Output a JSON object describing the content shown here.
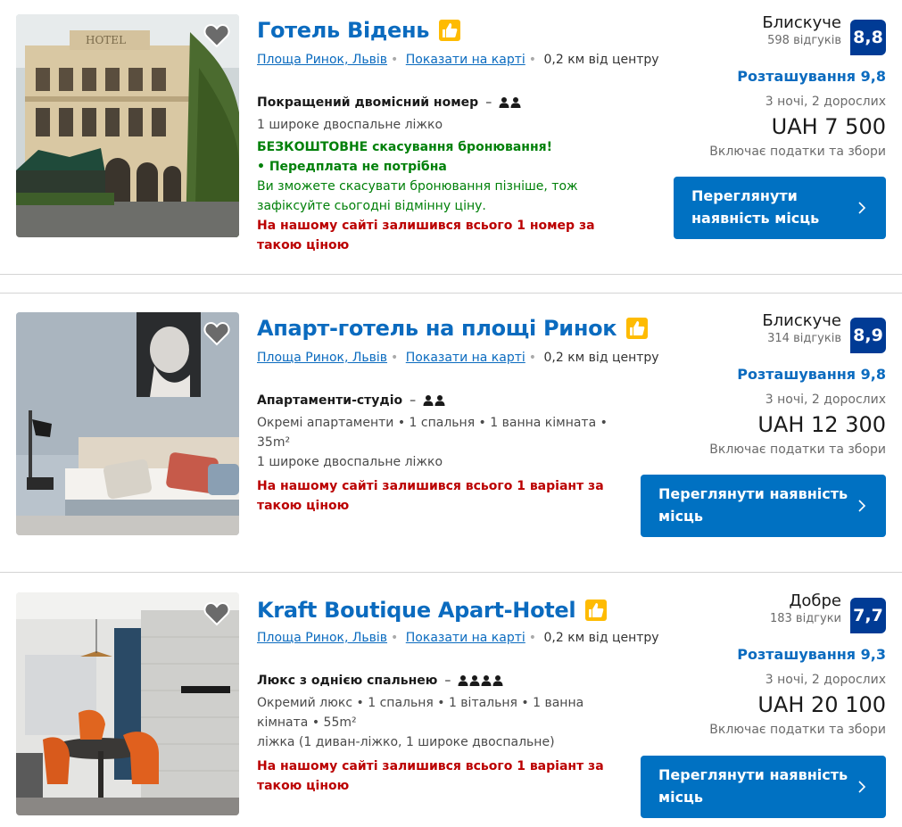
{
  "listings": [
    {
      "title": "Готель Відень",
      "address": "Площа Ринок, Львів",
      "map_link": "Показати на карті",
      "distance": "0,2 км від центру",
      "room_name": "Покращений двомісний номер",
      "room_desc": "",
      "bed": "1 широке двоспальне ліжко",
      "free_cancel": "БЕЗКОШТОВНЕ скасування бронювання!",
      "no_prepay": "• Передплата не потрібна",
      "cancel_note": "Ви зможете скасувати бронювання пізніше, тож зафіксуйте сьогодні відмінну ціну.",
      "scarcity": "На нашому сайті залишився всього 1 номер за такою ціною",
      "score_word": "Блискуче",
      "reviews": "598 відгуків",
      "score": "8,8",
      "location_score": "Розташування 9,8",
      "stay": "3 ночі, 2 дорослих",
      "price": "UAH 7 500",
      "taxes": "Включає податки та збори",
      "cta": "Переглянути наявність місць",
      "occupancy": 2
    },
    {
      "title": "Апарт-готель на площі Ринок",
      "address": "Площа Ринок, Львів",
      "map_link": "Показати на карті",
      "distance": "0,2 км від центру",
      "room_name": "Апартаменти-студіо",
      "room_desc": "Окремі апартаменти • 1 спальня • 1 ванна кімната • 35m²",
      "bed": "1 широке двоспальне ліжко",
      "scarcity": "На нашому сайті залишився всього 1 варіант за такою ціною",
      "score_word": "Блискуче",
      "reviews": "314 відгуків",
      "score": "8,9",
      "location_score": "Розташування 9,8",
      "stay": "3 ночі, 2 дорослих",
      "price": "UAH 12 300",
      "taxes": "Включає податки та збори",
      "cta": "Переглянути наявність місць",
      "occupancy": 2
    },
    {
      "title": "Kraft Boutique Apart-Hotel",
      "address": "Площа Ринок, Львів",
      "map_link": "Показати на карті",
      "distance": "0,2 км від центру",
      "room_name": "Люкс з однією спальнею",
      "room_desc": "Окремий люкс • 1 спальня • 1 вітальня • 1 ванна кімната • 55m²",
      "bed": "ліжка (1 диван-ліжко, 1 широке двоспальне)",
      "scarcity": "На нашому сайті залишився всього 1 варіант за такою ціною",
      "score_word": "Добре",
      "reviews": "183 відгуки",
      "score": "7,7",
      "location_score": "Розташування 9,3",
      "stay": "3 ночі, 2 дорослих",
      "price": "UAH 20 100",
      "taxes": "Включає податки та збори",
      "cta": "Переглянути наявність місць",
      "occupancy": 4
    }
  ],
  "colors": {
    "link_blue": "#0b6bbf",
    "cta_blue": "#0071c2",
    "badge_blue": "#003b95",
    "green": "#008009",
    "red": "#bb0000",
    "thumb_yellow": "#febb02"
  },
  "icons": [
    "heart-icon",
    "thumbs-up-icon",
    "person-icon",
    "chevron-right-icon"
  ]
}
